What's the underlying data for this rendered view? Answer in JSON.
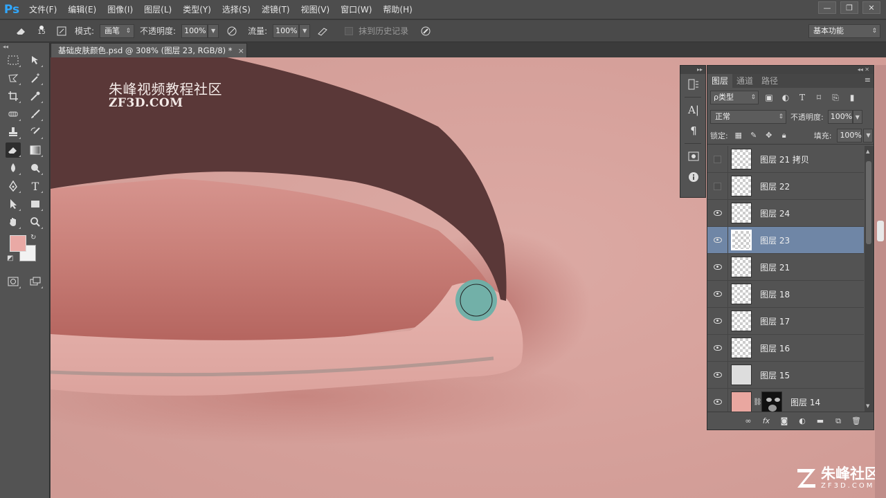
{
  "app": {
    "logo": "Ps"
  },
  "menu": [
    "文件(F)",
    "编辑(E)",
    "图像(I)",
    "图层(L)",
    "类型(Y)",
    "选择(S)",
    "滤镜(T)",
    "视图(V)",
    "窗口(W)",
    "帮助(H)"
  ],
  "window_controls": {
    "minimize": "—",
    "restore": "❐",
    "close": "✕"
  },
  "options": {
    "brush_size": "15",
    "mode_label": "模式:",
    "mode_value": "画笔",
    "opacity_label": "不透明度:",
    "opacity_value": "100%",
    "flow_label": "流量:",
    "flow_value": "100%",
    "history_label": "抹到历史记录",
    "workspace": "基本功能"
  },
  "document": {
    "tab_title": "基础皮肤颜色.psd @ 308% (图层 23, RGB/8) *",
    "close": "×"
  },
  "canvas": {
    "watermark_cn": "朱峰视频教程社区",
    "watermark_en": "ZF3D.COM",
    "brand_cn": "朱峰社区",
    "brand_en": "ZF3D.COM",
    "skin_color": "#d8a39d",
    "lash_color": "#5a3838",
    "brush_cursor_color": "#6bb0a8"
  },
  "colors": {
    "foreground": "#e9a9a5",
    "background": "#f2f2f2",
    "accent_selected": "#6f86a6"
  },
  "layers_panel": {
    "tabs": [
      "图层",
      "通道",
      "路径"
    ],
    "active_tab": 0,
    "filter_kind": "ρ类型",
    "blend_mode": "正常",
    "opacity_label": "不透明度:",
    "opacity_value": "100%",
    "lock_label": "锁定:",
    "fill_label": "填充:",
    "fill_value": "100%",
    "layers": [
      {
        "name": "图层 21 拷贝",
        "visible": false,
        "selected": false,
        "thumb": "transparent"
      },
      {
        "name": "图层 22",
        "visible": false,
        "selected": false,
        "thumb": "transparent"
      },
      {
        "name": "图层 24",
        "visible": true,
        "selected": false,
        "thumb": "transparent"
      },
      {
        "name": "图层 23",
        "visible": true,
        "selected": true,
        "thumb": "transparent"
      },
      {
        "name": "图层 21",
        "visible": true,
        "selected": false,
        "thumb": "transparent"
      },
      {
        "name": "图层 18",
        "visible": true,
        "selected": false,
        "thumb": "transparent"
      },
      {
        "name": "图层 17",
        "visible": true,
        "selected": false,
        "thumb": "transparent"
      },
      {
        "name": "图层 16",
        "visible": true,
        "selected": false,
        "thumb": "transparent"
      },
      {
        "name": "图层 15",
        "visible": true,
        "selected": false,
        "thumb": "transparent"
      },
      {
        "name": "图层 14",
        "visible": true,
        "selected": false,
        "thumb": "face-with-mask"
      }
    ]
  }
}
